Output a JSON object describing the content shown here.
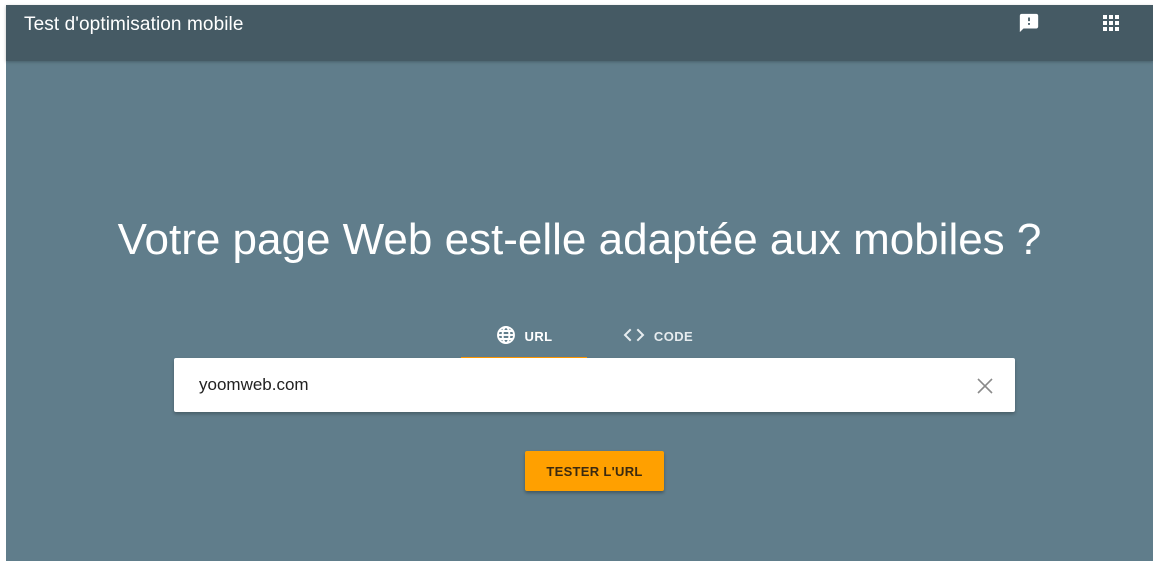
{
  "header": {
    "title": "Test d'optimisation mobile",
    "icons": [
      "feedback-icon",
      "apps-grid-icon"
    ]
  },
  "main": {
    "headline": "Votre page Web est-elle adaptée aux mobiles ?",
    "tabs": [
      {
        "label": "URL",
        "icon": "globe-icon",
        "selected": true
      },
      {
        "label": "CODE",
        "icon": "code-icon",
        "selected": false
      }
    ],
    "url_input": {
      "value": "yoomweb.com",
      "clear_icon": "close-icon"
    },
    "submit_label": "TESTER L'URL"
  },
  "colors": {
    "header_bg": "#455a64",
    "page_bg": "#607d8b",
    "accent": "#ffa000",
    "tab_indicator": "#ff9800"
  }
}
